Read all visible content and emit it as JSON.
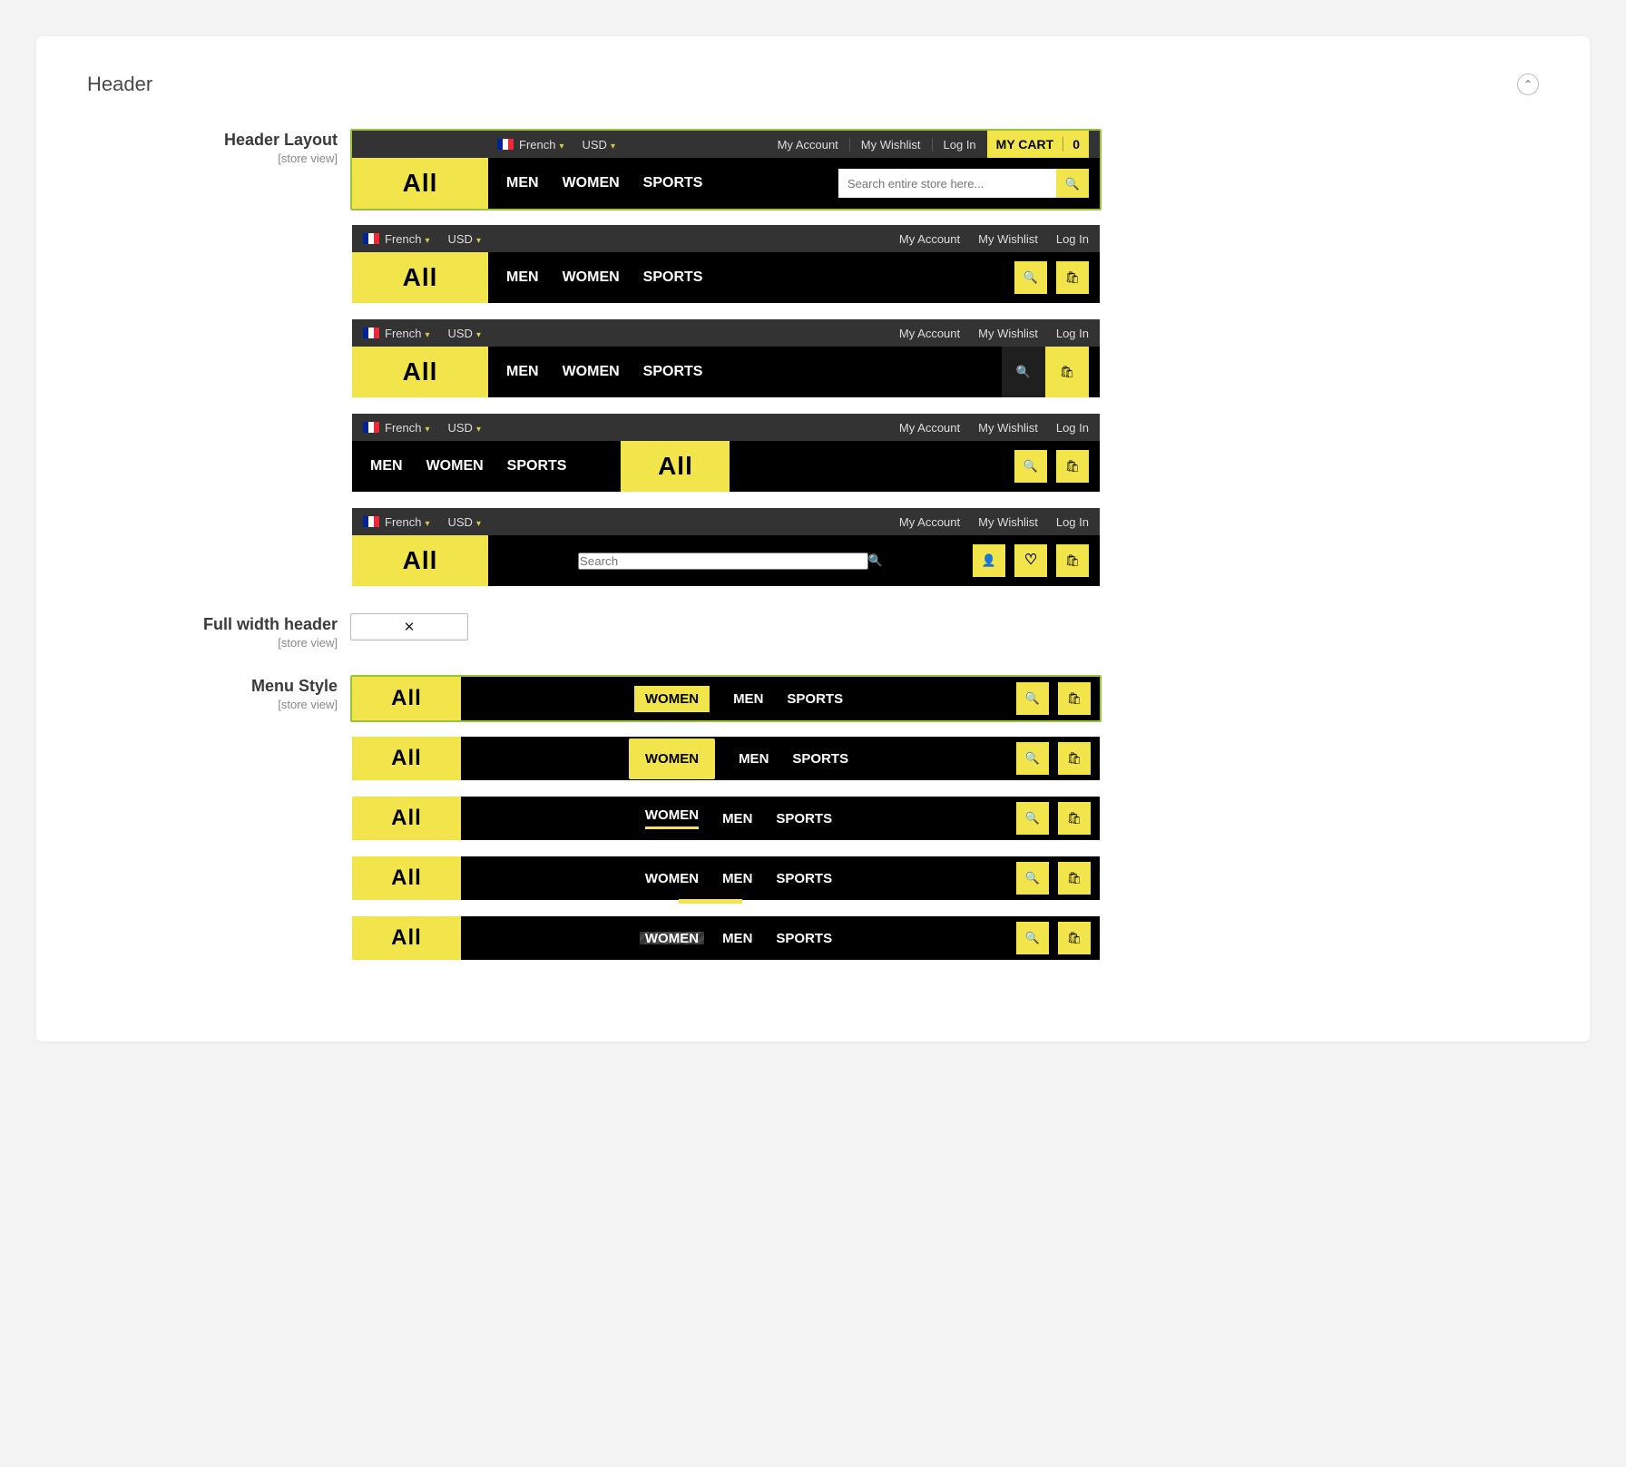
{
  "section": {
    "title": "Header"
  },
  "fields": {
    "header_layout": {
      "label": "Header Layout",
      "scope": "[store view]"
    },
    "full_width": {
      "label": "Full width header",
      "scope": "[store view]",
      "value": "✕"
    },
    "menu_style": {
      "label": "Menu Style",
      "scope": "[store view]"
    }
  },
  "common": {
    "logo": "All",
    "lang": "French",
    "currency": "USD",
    "links": {
      "account": "My Account",
      "wishlist": "My Wishlist",
      "login": "Log In"
    },
    "nav": {
      "men": "MEN",
      "women": "WOMEN",
      "sports": "SPORTS"
    },
    "search_placeholder_long": "Search entire store here...",
    "search_placeholder_short": "Search",
    "cart_label": "MY CART",
    "cart_count": "0"
  }
}
